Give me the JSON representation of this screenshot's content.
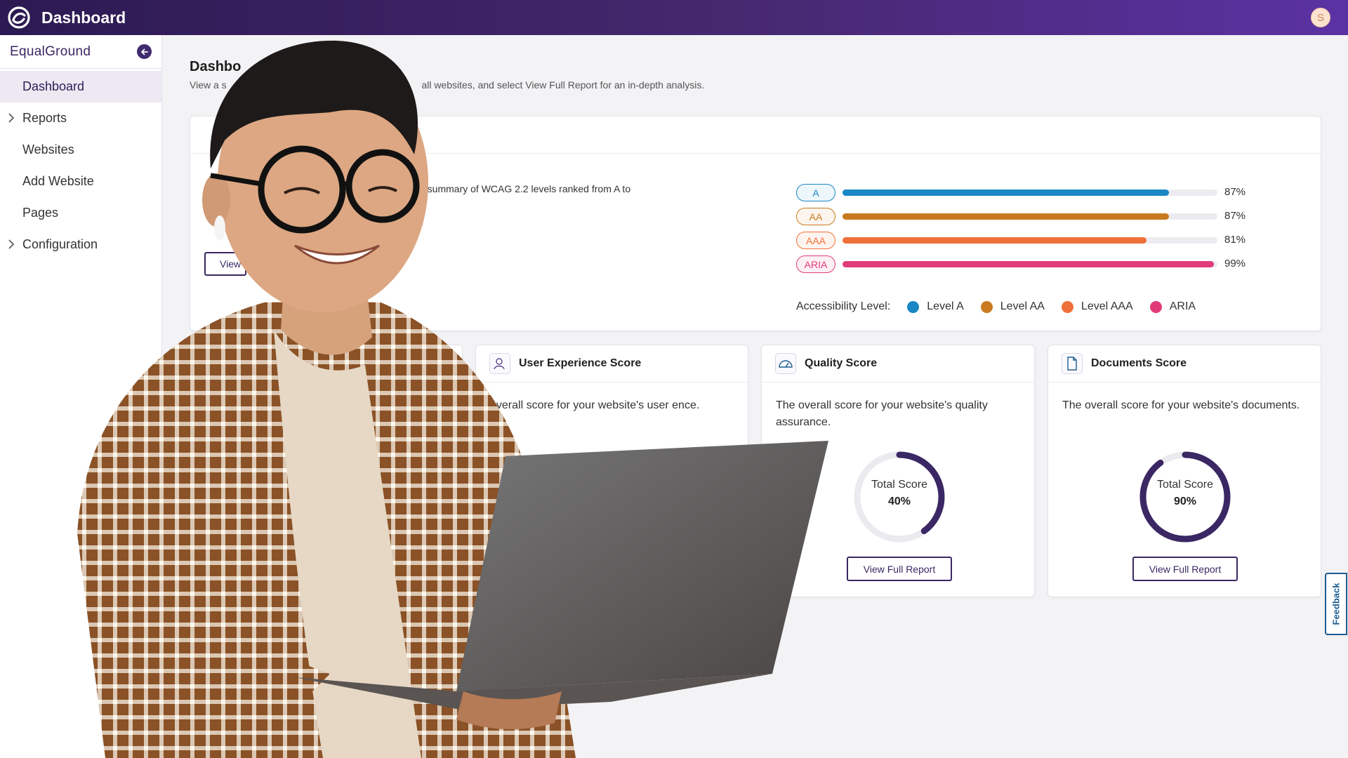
{
  "topbar": {
    "title": "Dashboard",
    "avatar_initial": "S"
  },
  "sidebar": {
    "brand": "EqualGround",
    "items": [
      {
        "label": "Dashboard",
        "active": true,
        "expandable": false
      },
      {
        "label": "Reports",
        "active": false,
        "expandable": true
      },
      {
        "label": "Websites",
        "active": false,
        "expandable": false
      },
      {
        "label": "Add Website",
        "active": false,
        "expandable": false
      },
      {
        "label": "Pages",
        "active": false,
        "expandable": false
      },
      {
        "label": "Configuration",
        "active": false,
        "expandable": true
      }
    ]
  },
  "page": {
    "title": "Dashbo",
    "description_start": "View a s",
    "description_end": "all websites, and select View Full Report for an in-depth analysis."
  },
  "wcag_card": {
    "description": "a summary of WCAG 2.2 levels ranked from A to",
    "button_label": "View",
    "levels": [
      {
        "label": "A",
        "percent": 87,
        "color": "#1a87c4"
      },
      {
        "label": "AA",
        "percent": 87,
        "color": "#c97a1f"
      },
      {
        "label": "AAA",
        "percent": 81,
        "color": "#ef7038"
      },
      {
        "label": "ARIA",
        "percent": 99,
        "color": "#e13b7a"
      }
    ],
    "pct_labels": [
      "87%",
      "87%",
      "81%",
      "99%"
    ],
    "legend_title": "Accessibility Level:",
    "legend": [
      {
        "label": "Level A",
        "color": "#1a87c4"
      },
      {
        "label": "Level AA",
        "color": "#c97a1f"
      },
      {
        "label": "Level AAA",
        "color": "#ef7038"
      },
      {
        "label": "ARIA",
        "color": "#e13b7a"
      }
    ]
  },
  "score_cards": [
    {
      "title": "User Experience Score",
      "icon": "user-icon",
      "description": "overall score for your website's user ence."
    },
    {
      "title": "Quality Score",
      "icon": "gauge-icon",
      "description": "The overall score for your website's quality assurance.",
      "score_label": "Total Score",
      "score_value": "40%",
      "score_fraction": 0.4,
      "button_label": "View Full Report"
    },
    {
      "title": "Documents Score",
      "icon": "document-icon",
      "description": "The overall score for your website's documents.",
      "score_label": "Total Score",
      "score_value": "90%",
      "score_fraction": 0.9,
      "button_label": "View Full Report"
    }
  ],
  "feedback_label": "Feedback",
  "colors": {
    "brand_purple": "#3a2763",
    "topbar_start": "#2c1a52",
    "topbar_end": "#5b32a3"
  }
}
